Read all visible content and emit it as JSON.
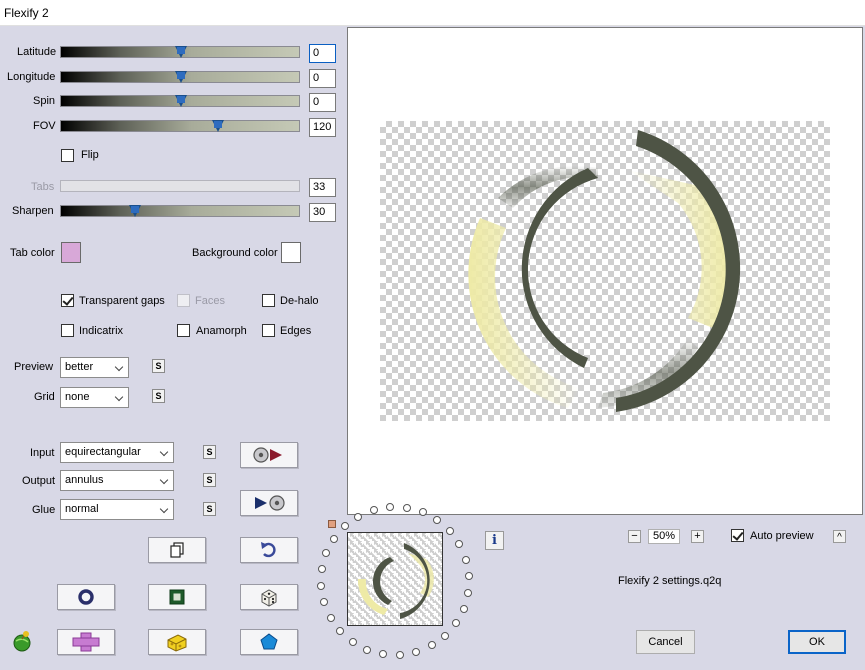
{
  "window": {
    "title": "Flexify 2"
  },
  "sliders": {
    "latitude": {
      "label": "Latitude",
      "value": "0",
      "level": 0.5
    },
    "longitude": {
      "label": "Longitude",
      "value": "0",
      "level": 0.5
    },
    "spin": {
      "label": "Spin",
      "value": "0",
      "level": 0.5
    },
    "fov": {
      "label": "FOV",
      "value": "120",
      "level": 0.65
    },
    "tabs": {
      "label": "Tabs",
      "value": "33",
      "disabled": true
    },
    "sharpen": {
      "label": "Sharpen",
      "value": "30",
      "level": 0.3
    }
  },
  "flip": {
    "label": "Flip",
    "checked": false
  },
  "colors": {
    "tab_color_label": "Tab color",
    "tab_color": "#d8a8d8",
    "background_color_label": "Background color",
    "background_color": "#ffffff"
  },
  "options": {
    "transparent_gaps": {
      "label": "Transparent gaps",
      "checked": true
    },
    "faces": {
      "label": "Faces",
      "checked": false,
      "disabled": true
    },
    "de_halo": {
      "label": "De-halo",
      "checked": false
    },
    "indicatrix": {
      "label": "Indicatrix",
      "checked": false
    },
    "anamorph": {
      "label": "Anamorph",
      "checked": false
    },
    "edges": {
      "label": "Edges",
      "checked": false
    }
  },
  "dropdowns": {
    "preview": {
      "label": "Preview",
      "value": "better"
    },
    "grid": {
      "label": "Grid",
      "value": "none"
    },
    "input": {
      "label": "Input",
      "value": "equirectangular"
    },
    "output": {
      "label": "Output",
      "value": "annulus"
    },
    "glue": {
      "label": "Glue",
      "value": "normal"
    }
  },
  "s_button_label": "S",
  "zoom": {
    "minus": "−",
    "value": "50%",
    "plus": "+"
  },
  "auto_preview": {
    "label": "Auto preview",
    "checked": true
  },
  "collapse_label": "^",
  "info_label": "i",
  "settings_file": "Flexify 2 settings.q2q",
  "buttons": {
    "cancel": "Cancel",
    "ok": "OK"
  },
  "accent_colors": {
    "ring_dark": "#4e5445",
    "ring_light": "#eeeaa6",
    "ok_border": "#0a64c8"
  }
}
